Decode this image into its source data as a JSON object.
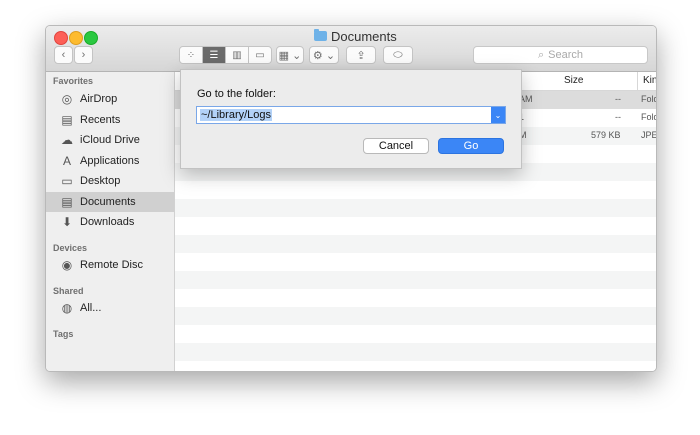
{
  "window": {
    "title": "Documents"
  },
  "toolbar": {
    "back_glyph": "‹",
    "forward_glyph": "›",
    "view_icon_glyph": "⁘",
    "view_list_glyph": "☰",
    "view_column_glyph": "▥",
    "view_gallery_glyph": "▭",
    "group_glyph": "▦ ⌄",
    "action_glyph": "⚙ ⌄",
    "share_glyph": "⇪",
    "tag_glyph": "⬭",
    "search_placeholder": "Search"
  },
  "sidebar": {
    "favorites_header": "Favorites",
    "favorites": [
      {
        "label": "AirDrop",
        "icon": "airdrop-icon",
        "glyph": "◎"
      },
      {
        "label": "Recents",
        "icon": "recents-icon",
        "glyph": "▤"
      },
      {
        "label": "iCloud Drive",
        "icon": "cloud-icon",
        "glyph": "☁"
      },
      {
        "label": "Applications",
        "icon": "applications-icon",
        "glyph": "A"
      },
      {
        "label": "Desktop",
        "icon": "desktop-icon",
        "glyph": "▭"
      },
      {
        "label": "Documents",
        "icon": "documents-icon",
        "glyph": "▤"
      },
      {
        "label": "Downloads",
        "icon": "downloads-icon",
        "glyph": "⬇"
      }
    ],
    "devices_header": "Devices",
    "devices": [
      {
        "label": "Remote Disc",
        "icon": "disc-icon",
        "glyph": "◉"
      }
    ],
    "shared_header": "Shared",
    "shared": [
      {
        "label": "All...",
        "icon": "network-icon",
        "glyph": "◍"
      }
    ],
    "tags_header": "Tags"
  },
  "list": {
    "columns": {
      "size": "Size",
      "kind": "Kind"
    },
    "rows": [
      {
        "date_fragment": "AM",
        "size": "--",
        "kind": "Fold"
      },
      {
        "date_fragment": "1",
        "size": "--",
        "kind": "Fold"
      },
      {
        "date_fragment": "M",
        "size": "579 KB",
        "kind": "JPE"
      }
    ]
  },
  "dialog": {
    "label": "Go to the folder:",
    "path_value": "~/Library/Logs",
    "arrow_glyph": "⌄",
    "cancel_label": "Cancel",
    "go_label": "Go"
  },
  "colors": {
    "accent": "#3b86f6",
    "selection": "#b3d2f8"
  }
}
